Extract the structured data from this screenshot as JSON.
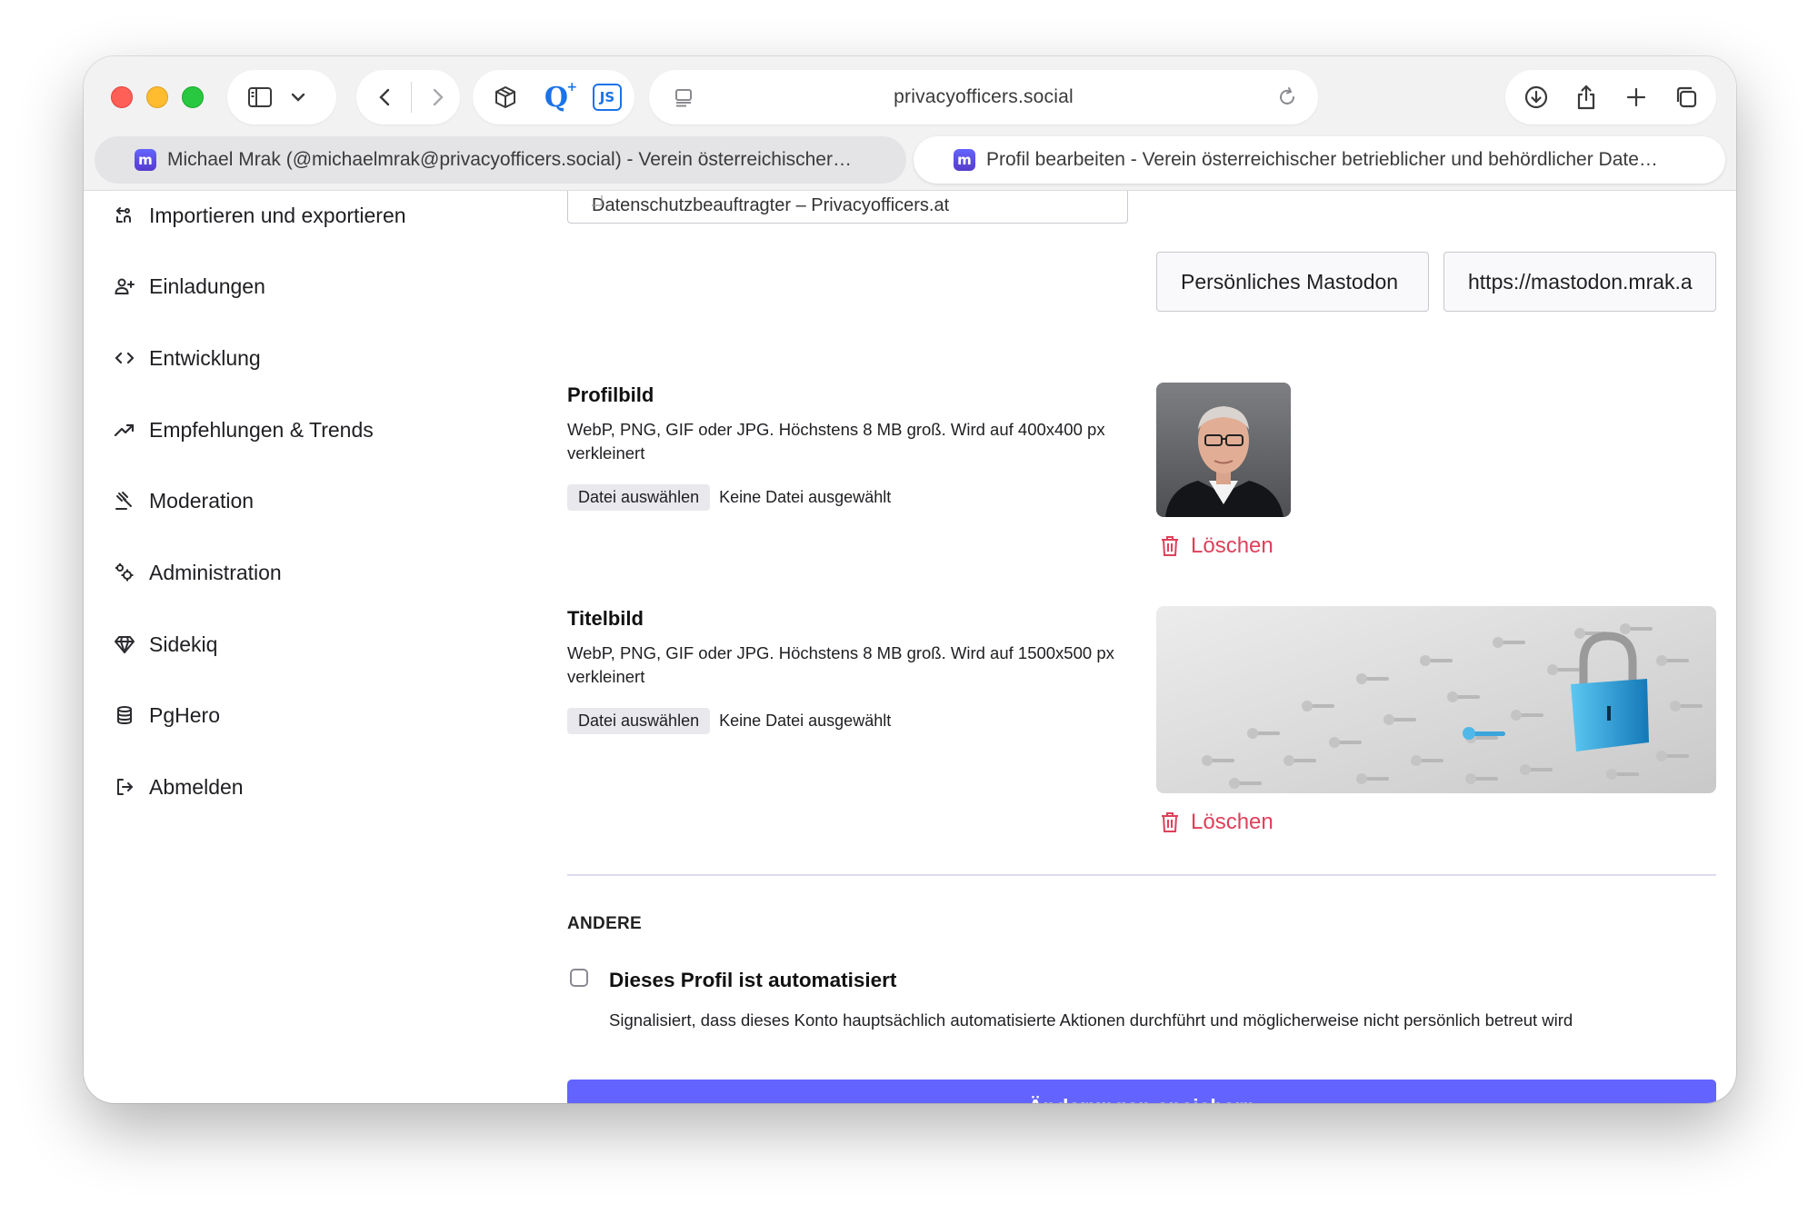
{
  "browser": {
    "url": "privacyofficers.social",
    "tabs": [
      {
        "title": "Michael Mrak (@michaelmrak@privacyofficers.social) - Verein österreichischer…",
        "active": false
      },
      {
        "title": "Profil bearbeiten - Verein österreichischer betrieblicher und behördlicher Date…",
        "active": true
      }
    ],
    "favicon_letter": "m",
    "extension_js_label": "JS",
    "extension_q_label": "Q"
  },
  "sidebar": {
    "items": [
      {
        "label": "Importieren und exportieren",
        "icon": "import-export-icon"
      },
      {
        "label": "Einladungen",
        "icon": "person-add-icon"
      },
      {
        "label": "Entwicklung",
        "icon": "code-icon"
      },
      {
        "label": "Empfehlungen & Trends",
        "icon": "trending-icon"
      },
      {
        "label": "Moderation",
        "icon": "gavel-icon"
      },
      {
        "label": "Administration",
        "icon": "gears-icon"
      },
      {
        "label": "Sidekiq",
        "icon": "diamond-icon"
      },
      {
        "label": "PgHero",
        "icon": "database-icon"
      },
      {
        "label": "Abmelden",
        "icon": "logout-icon"
      }
    ]
  },
  "form": {
    "bio_fragment": "Datenschutzbeauftragter – Privacyofficers.at",
    "metadata_label": "Persönliches Mastodon",
    "metadata_value": "https://mastodon.mrak.a",
    "avatar": {
      "title": "Profilbild",
      "hint": "WebP, PNG, GIF oder JPG. Höchstens 8 MB groß. Wird auf 400x400 px verkleinert",
      "file_button": "Datei auswählen",
      "file_status": "Keine Datei ausgewählt",
      "delete_label": "Löschen"
    },
    "header": {
      "title": "Titelbild",
      "hint": "WebP, PNG, GIF oder JPG. Höchstens 8 MB groß. Wird auf 1500x500 px verkleinert",
      "file_button": "Datei auswählen",
      "file_status": "Keine Datei ausgewählt",
      "delete_label": "Löschen"
    },
    "other": {
      "section_title": "ANDERE",
      "bot_label": "Dieses Profil ist automatisiert",
      "bot_hint": "Signalisiert, dass dieses Konto hauptsächlich automatisierte Aktionen durchführt und möglicherweise nicht persönlich betreut wird",
      "bot_checked": false
    },
    "save_label": "Änderungen speichern"
  },
  "colors": {
    "accent": "#6364ff",
    "danger": "#df405a",
    "toolbar_bg": "#f2f2f3"
  }
}
